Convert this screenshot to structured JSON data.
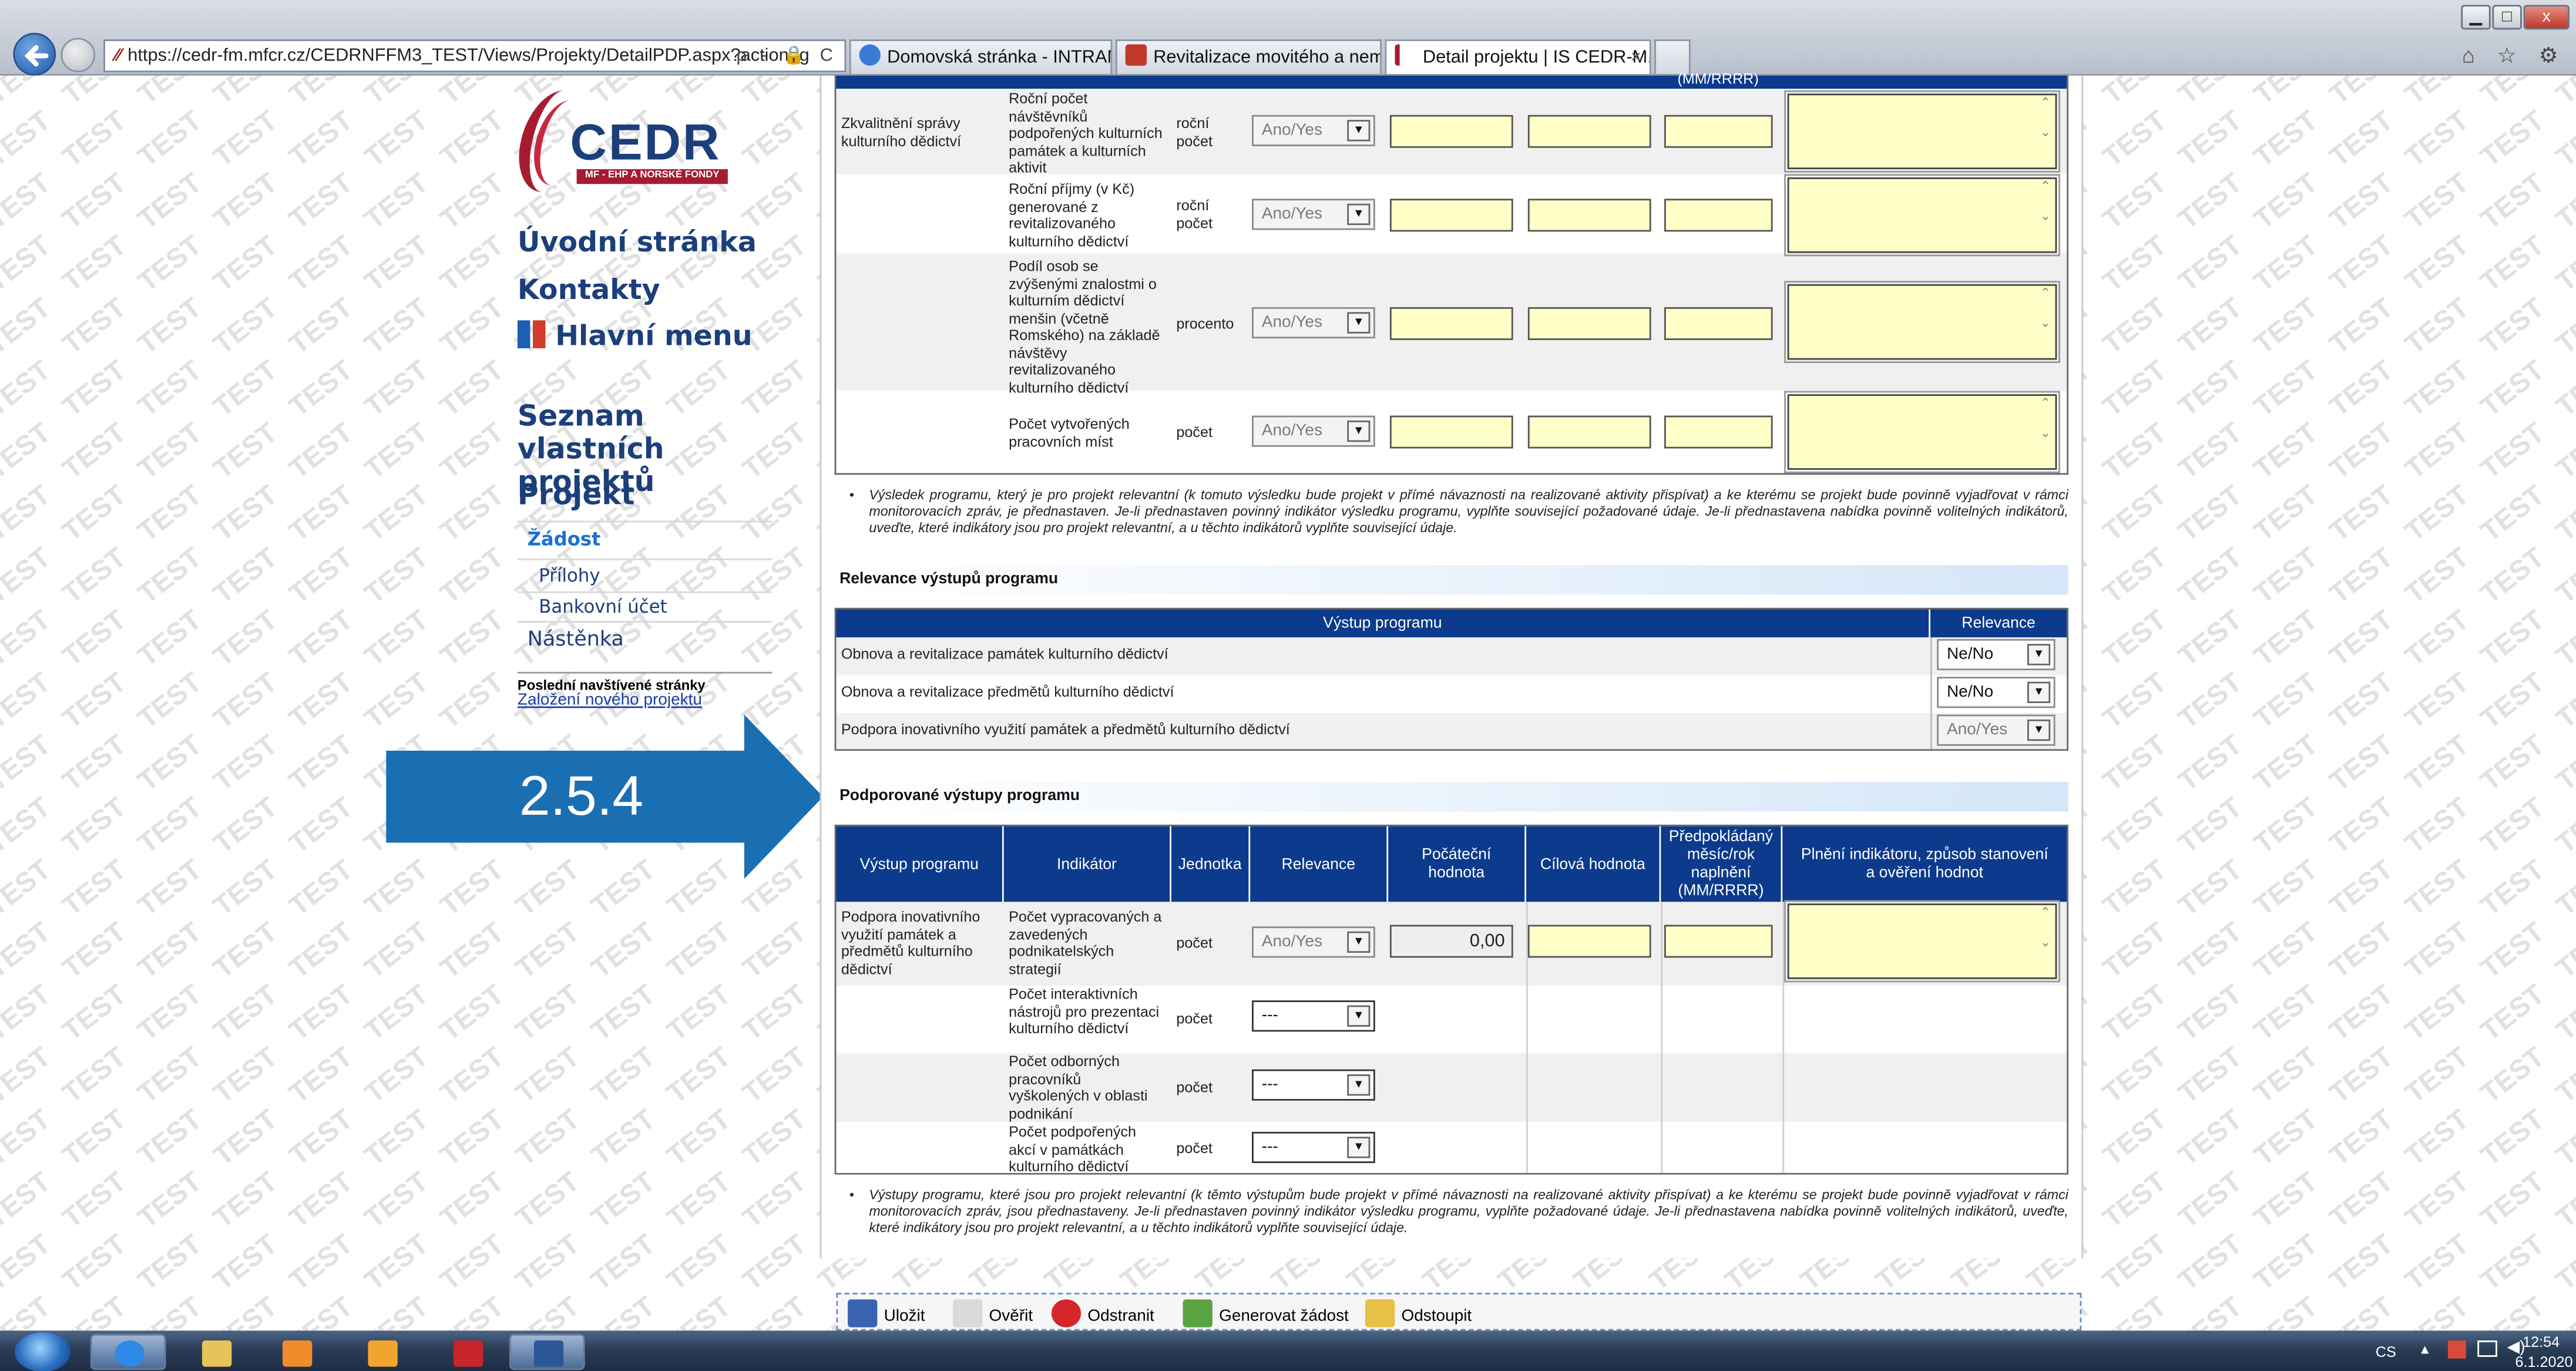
{
  "browser": {
    "url": "https://cedr-fm.mfcr.cz/CEDRNFFM3_TEST/Views/Projekty/DetailPDP.aspx?action=g",
    "url_controls": "ρ - 🔒 C",
    "tabs": [
      {
        "label": "Domovská stránka - INTRANE...",
        "icon_color": "#3b7bd6"
      },
      {
        "label": "Revitalizace movitého a nemo...",
        "icon_color": "#c0392b"
      },
      {
        "label": "Detail projektu | IS CEDR-M...",
        "icon_color": "#a51c30",
        "close": "×"
      }
    ],
    "window_controls": {
      "min": "▁",
      "max": "□",
      "close": "x"
    },
    "toolbar_icons": "⌂ ☆ ⚙"
  },
  "watermark_text": "TEST",
  "logo": {
    "word": "CEDR",
    "tagline": "MF - EHP A NORSKÉ FONDY"
  },
  "nav": {
    "home": "Úvodní stránka",
    "contacts": "Kontakty",
    "main_menu": "Hlavní menu",
    "own_projects": "Seznam vlastních projektů",
    "project": "Projekt",
    "application": "Žádost",
    "attachments": "Přílohy",
    "bank_account": "Bankovní účet",
    "board": "Nástěnka",
    "recent_label": "Poslední navštívené stránky",
    "recent_link": "Založení nového projektu"
  },
  "callout": {
    "label": "2.5.4",
    "color": "#1a6fb3"
  },
  "results_table": {
    "group_label": "Zkvalitnění správy kulturního dědictví",
    "header_fragment": "(MM/RRRR)",
    "rows": [
      {
        "indicator": "Roční počet návštěvníků podpořených kulturních památek a kulturních aktivit",
        "unit": "roční počet",
        "relevance": "Ano/Yes"
      },
      {
        "indicator": "Roční příjmy (v Kč) generované z revitalizovaného kulturního dědictví",
        "unit": "roční počet",
        "relevance": "Ano/Yes"
      },
      {
        "indicator": "Podíl osob se zvýšenými znalostmi o kulturním dědictví menšin (včetně Romského) na základě návštěvy revitalizovaného kulturního dědictví",
        "unit": "procento",
        "relevance": "Ano/Yes"
      },
      {
        "indicator": "Počet vytvořených pracovních míst",
        "unit": "počet",
        "relevance": "Ano/Yes"
      }
    ],
    "note": "Výsledek programu, který je pro projekt relevantní (k tomuto výsledku bude projekt v přímé návaznosti na realizované aktivity přispívat) a ke kterému se projekt bude povinně vyjadřovat v rámci monitorovacích zpráv, je přednastaven. Je-li přednastaven povinný indikátor výsledku programu, vyplňte související požadované údaje. Je-li přednastavena nabídka povinně volitelných indikátorů, uveďte, které indikátory jsou pro projekt relevantní, a u těchto indikátorů vyplňte související údaje."
  },
  "outputs_relevance": {
    "heading": "Relevance výstupů programu",
    "col_output": "Výstup programu",
    "col_relevance": "Relevance",
    "rows": [
      {
        "label": "Obnova a revitalizace památek kulturního dědictví",
        "value": "Ne/No",
        "disabled": false
      },
      {
        "label": "Obnova a revitalizace předmětů kulturního dědictví",
        "value": "Ne/No",
        "disabled": false
      },
      {
        "label": "Podpora inovativního využití památek a předmětů kulturního dědictví",
        "value": "Ano/Yes",
        "disabled": true
      }
    ]
  },
  "supported_outputs": {
    "heading": "Podporované výstupy programu",
    "columns": [
      "Výstup programu",
      "Indikátor",
      "Jednotka",
      "Relevance",
      "Počáteční hodnota",
      "Cílová hodnota",
      "Předpokládaný měsíc/rok naplnění (MM/RRRR)",
      "Plnění indikátoru, způsob stanovení a ověření hodnot"
    ],
    "group_label": "Podpora inovativního využití památek a předmětů kulturního dědictví",
    "rows": [
      {
        "indicator": "Počet vypracovaných a zavedených podnikatelských strategií",
        "unit": "počet",
        "relevance": "Ano/Yes",
        "start_value": "0,00"
      },
      {
        "indicator": "Počet interaktivních nástrojů pro prezentaci kulturního dědictví",
        "unit": "počet",
        "relevance": "---"
      },
      {
        "indicator": "Počet odborných pracovníků vyškolených v oblasti podnikání",
        "unit": "počet",
        "relevance": "---"
      },
      {
        "indicator": "Počet podpořených akcí v památkách kulturního dědictví",
        "unit": "počet",
        "relevance": "---"
      }
    ],
    "note": "Výstupy programu, které jsou pro projekt relevantní (k těmto výstupům bude projekt v přímé návaznosti na realizované aktivity přispívat) a ke kterému se projekt bude povinně vyjadřovat v rámci monitorovacích zpráv, jsou přednastaveny. Je-li přednastaven povinný indikátor výsledku programu, vyplňte požadované údaje. Je-li přednastavena nabídka povinně volitelných indikátorů, uveďte, které indikátory jsou pro projekt relevantní, a u těchto indikátorů vyplňte související údaje."
  },
  "actions": {
    "save": "Uložit",
    "verify": "Ověřit",
    "remove": "Odstranit",
    "generate": "Generovat žádost",
    "withdraw": "Odstoupit"
  },
  "taskbar": {
    "lang": "CS",
    "time": "12:54",
    "date": "6.1.2020"
  }
}
